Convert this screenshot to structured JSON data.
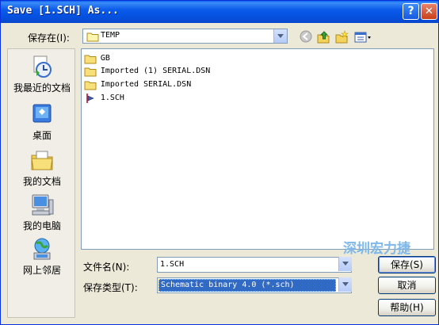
{
  "window": {
    "title": "Save [1.SCH] As...",
    "help_glyph": "?",
    "close_glyph": "✕"
  },
  "save_in": {
    "label": "保存在(I):",
    "value": "TEMP"
  },
  "places": [
    {
      "label": "我最近的文档",
      "icon": "recent-documents-icon"
    },
    {
      "label": "桌面",
      "icon": "desktop-icon"
    },
    {
      "label": "我的文档",
      "icon": "my-documents-icon"
    },
    {
      "label": "我的电脑",
      "icon": "my-computer-icon"
    },
    {
      "label": "网上邻居",
      "icon": "network-places-icon"
    }
  ],
  "files": [
    {
      "name": "GB",
      "type": "folder"
    },
    {
      "name": "Imported (1) SERIAL.DSN",
      "type": "folder"
    },
    {
      "name": "Imported SERIAL.DSN",
      "type": "folder"
    },
    {
      "name": "1.SCH",
      "type": "schematic"
    }
  ],
  "watermark": "深圳宏力捷",
  "file_name": {
    "label": "文件名(N):",
    "value": "1.SCH"
  },
  "save_type": {
    "label": "保存类型(T):",
    "value": "Schematic binary 4.0 (*.sch)"
  },
  "buttons": {
    "save": "保存(S)",
    "cancel": "取消",
    "help": "帮助(H)"
  },
  "colors": {
    "titlebar": "#0a58e8",
    "selection": "#316ac5",
    "dialog_bg": "#ece9d8"
  }
}
